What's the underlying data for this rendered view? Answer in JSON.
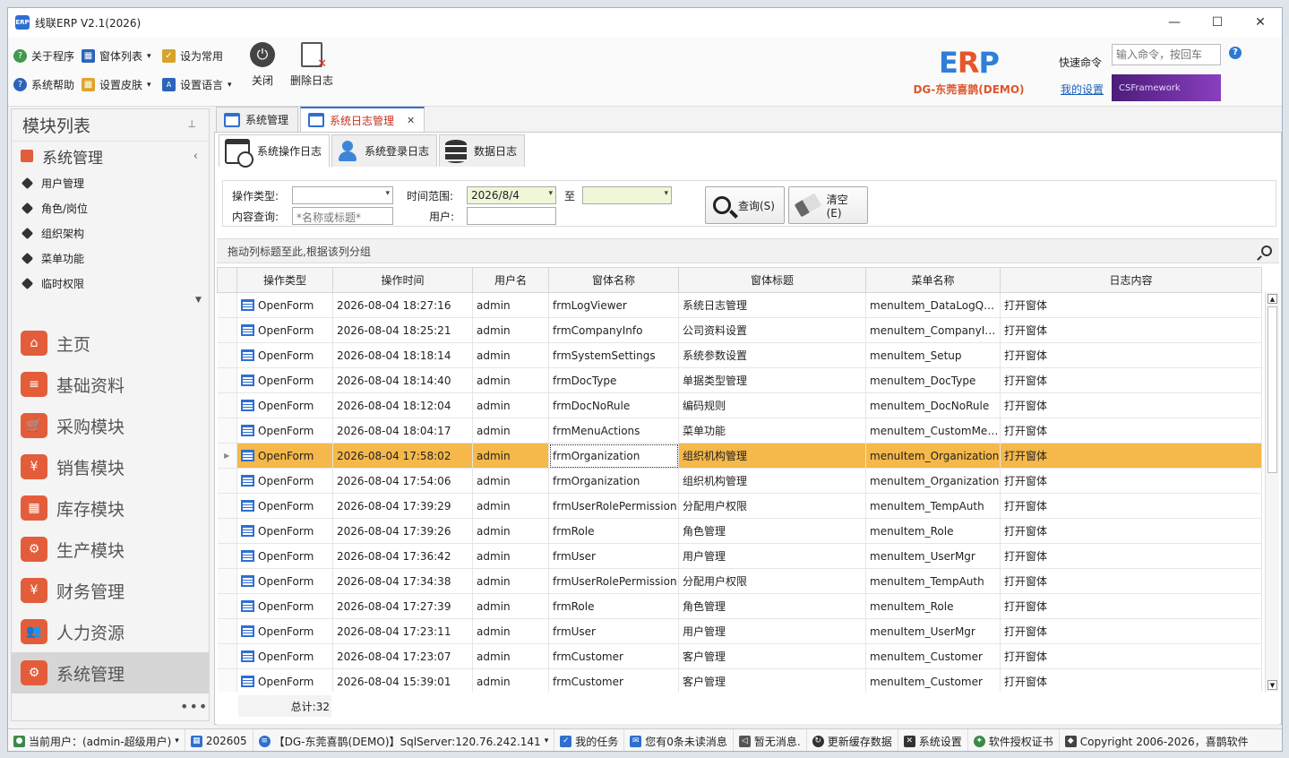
{
  "window": {
    "title": "线联ERP V2.1(2026)",
    "app_icon": "ERP",
    "controls": [
      "—",
      "☐",
      "✕"
    ]
  },
  "ribbon": {
    "about": "关于程序",
    "window_list": "窗体列表",
    "set_common": "设为常用",
    "help": "系统帮助",
    "skin": "设置皮肤",
    "language": "设置语言",
    "close": "关闭",
    "delete_log": "删除日志",
    "logo_e": "E",
    "logo_r": "R",
    "logo_p": "P",
    "company": "DG-东莞喜鹊(DEMO)",
    "quick_label": "快速命令",
    "quick_placeholder": "输入命令，按回车",
    "my_settings": "我的设置",
    "banner": "CSFramework"
  },
  "sidebar": {
    "title": "模块列表",
    "group": "系统管理",
    "sub_items": [
      "用户管理",
      "角色/岗位",
      "组织架构",
      "菜单功能",
      "临时权限"
    ],
    "modules": [
      {
        "label": "主页",
        "icon": "home-icon",
        "glyph": "⌂"
      },
      {
        "label": "基础资料",
        "icon": "folder-icon",
        "glyph": "≡"
      },
      {
        "label": "采购模块",
        "icon": "cart-icon",
        "glyph": "🛒"
      },
      {
        "label": "销售模块",
        "icon": "bag-icon",
        "glyph": "¥"
      },
      {
        "label": "库存模块",
        "icon": "warehouse-icon",
        "glyph": "▦"
      },
      {
        "label": "生产模块",
        "icon": "gears-icon",
        "glyph": "⚙"
      },
      {
        "label": "财务管理",
        "icon": "moneybag-icon",
        "glyph": "¥"
      },
      {
        "label": "人力资源",
        "icon": "people-icon",
        "glyph": "👥"
      },
      {
        "label": "系统管理",
        "icon": "system-icon",
        "glyph": "⚙"
      }
    ],
    "more": "•••"
  },
  "doc_tabs": [
    {
      "label": "系统管理"
    },
    {
      "label": "系统日志管理"
    }
  ],
  "sub_tabs": [
    "系统操作日志",
    "系统登录日志",
    "数据日志"
  ],
  "filter": {
    "op_type_label": "操作类型:",
    "time_label": "时间范围:",
    "date_from": "2026/8/4",
    "to_label": "至",
    "content_label": "内容查询:",
    "content_placeholder": "*名称或标题*",
    "user_label": "用户:",
    "query_button": "查询(S)",
    "clear_button": "清空(E)"
  },
  "grid": {
    "group_hint": "拖动列标题至此,根据该列分组",
    "columns": [
      "操作类型",
      "操作时间",
      "用户名",
      "窗体名称",
      "窗体标题",
      "菜单名称",
      "日志内容"
    ],
    "rows": [
      [
        "OpenForm",
        "2026-08-04 18:27:16",
        "admin",
        "frmLogViewer",
        "系统日志管理",
        "menuItem_DataLogQuery",
        "打开窗体"
      ],
      [
        "OpenForm",
        "2026-08-04 18:25:21",
        "admin",
        "frmCompanyInfo",
        "公司资料设置",
        "menuItem_CompanyInfo",
        "打开窗体"
      ],
      [
        "OpenForm",
        "2026-08-04 18:18:14",
        "admin",
        "frmSystemSettings",
        "系统参数设置",
        "menuItem_Setup",
        "打开窗体"
      ],
      [
        "OpenForm",
        "2026-08-04 18:14:40",
        "admin",
        "frmDocType",
        "单据类型管理",
        "menuItem_DocType",
        "打开窗体"
      ],
      [
        "OpenForm",
        "2026-08-04 18:12:04",
        "admin",
        "frmDocNoRule",
        "编码规则",
        "menuItem_DocNoRule",
        "打开窗体"
      ],
      [
        "OpenForm",
        "2026-08-04 18:04:17",
        "admin",
        "frmMenuActions",
        "菜单功能",
        "menuItem_CustomMen...",
        "打开窗体"
      ],
      [
        "OpenForm",
        "2026-08-04 17:58:02",
        "admin",
        "frmOrganization",
        "组织机构管理",
        "menuItem_Organization",
        "打开窗体"
      ],
      [
        "OpenForm",
        "2026-08-04 17:54:06",
        "admin",
        "frmOrganization",
        "组织机构管理",
        "menuItem_Organization",
        "打开窗体"
      ],
      [
        "OpenForm",
        "2026-08-04 17:39:29",
        "admin",
        "frmUserRolePermission",
        "分配用户权限",
        "menuItem_TempAuth",
        "打开窗体"
      ],
      [
        "OpenForm",
        "2026-08-04 17:39:26",
        "admin",
        "frmRole",
        "角色管理",
        "menuItem_Role",
        "打开窗体"
      ],
      [
        "OpenForm",
        "2026-08-04 17:36:42",
        "admin",
        "frmUser",
        "用户管理",
        "menuItem_UserMgr",
        "打开窗体"
      ],
      [
        "OpenForm",
        "2026-08-04 17:34:38",
        "admin",
        "frmUserRolePermission",
        "分配用户权限",
        "menuItem_TempAuth",
        "打开窗体"
      ],
      [
        "OpenForm",
        "2026-08-04 17:27:39",
        "admin",
        "frmRole",
        "角色管理",
        "menuItem_Role",
        "打开窗体"
      ],
      [
        "OpenForm",
        "2026-08-04 17:23:11",
        "admin",
        "frmUser",
        "用户管理",
        "menuItem_UserMgr",
        "打开窗体"
      ],
      [
        "OpenForm",
        "2026-08-04 17:23:07",
        "admin",
        "frmCustomer",
        "客户管理",
        "menuItem_Customer",
        "打开窗体"
      ],
      [
        "OpenForm",
        "2026-08-04 15:39:01",
        "admin",
        "frmCustomer",
        "客户管理",
        "menuItem_Customer",
        "打开窗体"
      ]
    ],
    "selected_row_index": 6,
    "total": "总计:32"
  },
  "statusbar": [
    "当前用户：(admin-超级用户)",
    "202605",
    "【DG-东莞喜鹊(DEMO)】SqlServer:120.76.242.141",
    "我的任务",
    "您有0条未读消息",
    "暂无消息.",
    "更新缓存数据",
    "系统设置",
    "软件授权证书",
    "Copyright 2006-2026，喜鹊软件"
  ]
}
